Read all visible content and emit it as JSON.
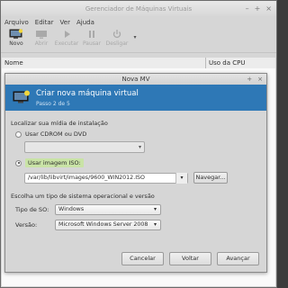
{
  "window": {
    "title": "Gerenciador de Máquinas Virtuais"
  },
  "menu": [
    "Arquivo",
    "Editar",
    "Ver",
    "Ajuda"
  ],
  "toolbar": {
    "novo": "Novo",
    "abrir": "Abrir",
    "executar": "Executar",
    "pausar": "Pausar",
    "desligar": "Desligar"
  },
  "list": {
    "col_name": "Nome",
    "col_cpu": "Uso da CPU"
  },
  "dialog": {
    "title": "Nova MV",
    "heading": "Criar nova máquina virtual",
    "step": "Passo 2 de 5",
    "install_section": "Localizar sua mídia de instalação",
    "radio_cdrom": "Usar CDROM ou DVD",
    "radio_iso": "Usar imagem ISO:",
    "iso_path": "/var/lib/libvirt/images/9600_WIN2012.ISO",
    "browse": "Navegar...",
    "os_section": "Escolha um tipo de sistema operacional e versão",
    "os_type_label": "Tipo de SO:",
    "os_type_value": "Windows",
    "version_label": "Versão:",
    "version_value": "Microsoft Windows Server 2008",
    "cancel": "Cancelar",
    "back": "Voltar",
    "forward": "Avançar"
  },
  "colors": {
    "banner": "#2e78b6",
    "selection": "#3a8e2b"
  }
}
